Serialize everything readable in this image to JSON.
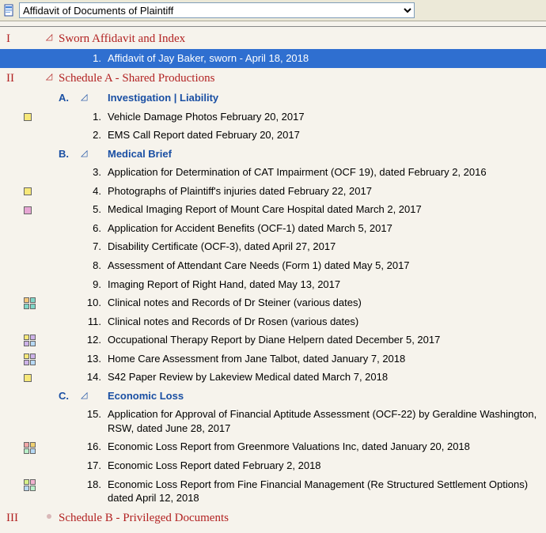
{
  "toolbar": {
    "dropdown_value": "Affidavit of Documents of Plaintiff"
  },
  "sections": [
    {
      "roman": "I",
      "marker": "triangle",
      "title": "Sworn Affidavit and Index",
      "subs": [],
      "direct_items": [
        {
          "n": "1.",
          "text": "Affidavit of Jay Baker, sworn - April 18, 2018",
          "selected": true
        }
      ]
    },
    {
      "roman": "II",
      "marker": "triangle",
      "title": "Schedule A - Shared Productions",
      "direct_items": [],
      "subs": [
        {
          "letter": "A.",
          "title": "Investigation | Liability",
          "items": [
            {
              "n": "1.",
              "text": "Vehicle Damage Photos February 20, 2017",
              "icon": {
                "type": "box",
                "c": [
                  "c-yellow"
                ]
              }
            },
            {
              "n": "2.",
              "text": "EMS Call Report dated February 20, 2017"
            }
          ]
        },
        {
          "letter": "B.",
          "title": "Medical Brief",
          "items": [
            {
              "n": "3.",
              "text": "Application for Determination of CAT Impairment (OCF 19), dated February 2, 2016"
            },
            {
              "n": "4.",
              "text": "Photographs of Plaintiff's injuries dated February 22, 2017",
              "icon": {
                "type": "box",
                "c": [
                  "c-yellow"
                ]
              }
            },
            {
              "n": "5.",
              "text": "Medical Imaging Report of Mount Care Hospital dated March 2, 2017",
              "icon": {
                "type": "box",
                "c": [
                  "c-pink"
                ]
              }
            },
            {
              "n": "6.",
              "text": "Application for Accident Benefits (OCF-1) dated March 5, 2017"
            },
            {
              "n": "7.",
              "text": "Disability Certificate (OCF-3), dated April 27, 2017"
            },
            {
              "n": "8.",
              "text": "Assessment of Attendant Care Needs (Form 1) dated May 5, 2017"
            },
            {
              "n": "9.",
              "text": "Imaging Report of Right Hand, dated May 13, 2017"
            },
            {
              "n": "10.",
              "text": "Clinical notes and Records of Dr Steiner (various dates)",
              "icon": {
                "type": "grid",
                "c": [
                  "c-orange",
                  "c-teal",
                  "c-teal",
                  "c-teal"
                ]
              }
            },
            {
              "n": "11.",
              "text": "Clinical notes and Records of Dr Rosen (various dates)"
            },
            {
              "n": "12.",
              "text": "Occupational Therapy Report by Diane Helpern dated December 5, 2017",
              "icon": {
                "type": "grid",
                "c": [
                  "c-yellow",
                  "c-lav",
                  "c-lav",
                  "c-sky"
                ]
              }
            },
            {
              "n": "13.",
              "text": "Home Care Assessment from Jane Talbot, dated January 7, 2018",
              "icon": {
                "type": "grid",
                "c": [
                  "c-yellow",
                  "c-lav",
                  "c-lav",
                  "c-sky"
                ]
              }
            },
            {
              "n": "14.",
              "text": "S42 Paper Review by Lakeview Medical dated March 7, 2018",
              "icon": {
                "type": "box",
                "c": [
                  "c-yellow"
                ]
              }
            }
          ]
        },
        {
          "letter": "C.",
          "title": "Economic Loss",
          "items": [
            {
              "n": "15.",
              "text": "Application for Approval of Financial Aptitude Assessment (OCF-22) by Geraldine Washington, RSW, dated June 28, 2017"
            },
            {
              "n": "16.",
              "text": "Economic Loss Report from Greenmore Valuations Inc, dated January 20, 2018",
              "icon": {
                "type": "grid",
                "c": [
                  "c-red",
                  "c-gold",
                  "c-mint",
                  "c-sky"
                ]
              }
            },
            {
              "n": "17.",
              "text": "Economic Loss Report dated February 2, 2018"
            },
            {
              "n": "18.",
              "text": "Economic Loss Report from Fine Financial Management (Re Structured Settlement Options) dated April 12, 2018",
              "icon": {
                "type": "grid",
                "c": [
                  "c-lime",
                  "c-rose",
                  "c-sky",
                  "c-mint"
                ]
              }
            }
          ]
        }
      ]
    },
    {
      "roman": "III",
      "marker": "dot",
      "title": "Schedule B - Privileged Documents",
      "direct_items": [],
      "subs": []
    }
  ]
}
